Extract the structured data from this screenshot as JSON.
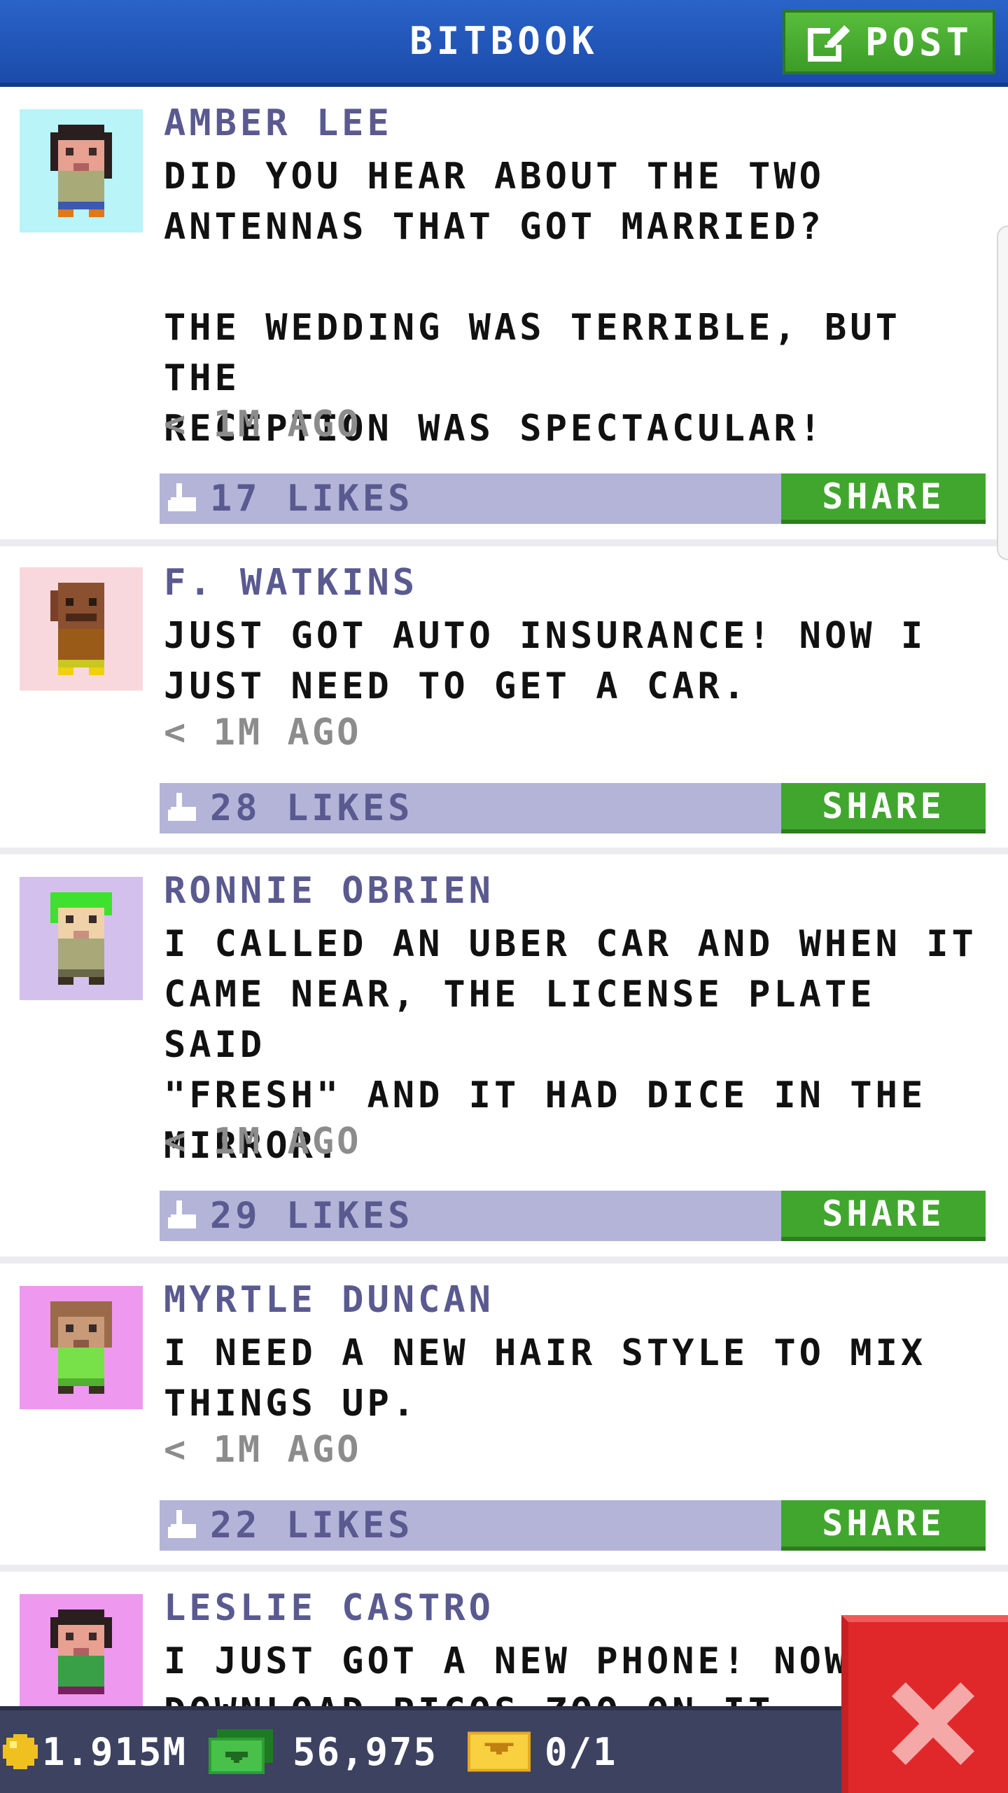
{
  "header": {
    "title": "BITBOOK",
    "post_label": "POST",
    "post_icon": "compose-icon"
  },
  "posts": [
    {
      "author": "AMBER LEE",
      "body": "DID YOU HEAR ABOUT THE TWO\nANTENNAS THAT GOT MARRIED?\n\nTHE WEDDING WAS TERRIBLE, BUT THE\nRECEPTION WAS SPECTACULAR!",
      "time": "< 1M AGO",
      "likes": "17 LIKES",
      "share": "SHARE",
      "avatar_bg": "#b8f4f8"
    },
    {
      "author": "F. WATKINS",
      "body": "JUST GOT AUTO INSURANCE! NOW I\nJUST NEED TO GET A CAR.",
      "time": "< 1M AGO",
      "likes": "28 LIKES",
      "share": "SHARE",
      "avatar_bg": "#f8d8dc"
    },
    {
      "author": "RONNIE OBRIEN",
      "body": "I CALLED AN UBER CAR AND WHEN IT\nCAME NEAR, THE LICENSE PLATE SAID\n\"FRESH\" AND IT HAD DICE IN THE\nMIRROR.",
      "time": "< 1M AGO",
      "likes": "29 LIKES",
      "share": "SHARE",
      "avatar_bg": "#d4c0ec"
    },
    {
      "author": "MYRTLE DUNCAN",
      "body": "I NEED A NEW HAIR STYLE TO MIX\nTHINGS UP.",
      "time": "< 1M AGO",
      "likes": "22 LIKES",
      "share": "SHARE",
      "avatar_bg": "#ee98f0"
    },
    {
      "author": "LESLIE CASTRO",
      "body": "I JUST GOT A NEW PHONE! NOW\nDOWNLOAD PICOS ZOO ON IT",
      "time": "",
      "likes": "",
      "share": "",
      "avatar_bg": "#ee98f0"
    }
  ],
  "bottom_bar": {
    "coins": "1.915M",
    "bux": "56,975",
    "tickets": "0/1"
  },
  "colors": {
    "header": "#1f52b8",
    "share_green": "#41a62e",
    "likes_bar": "#b3b4d8",
    "author_text": "#5a5a90",
    "close_red": "#e0282b"
  },
  "icons": {
    "close": "close-icon",
    "coin": "coin-icon",
    "bux": "bux-icon",
    "ticket": "ticket-icon",
    "like": "thumbs-up-icon"
  }
}
